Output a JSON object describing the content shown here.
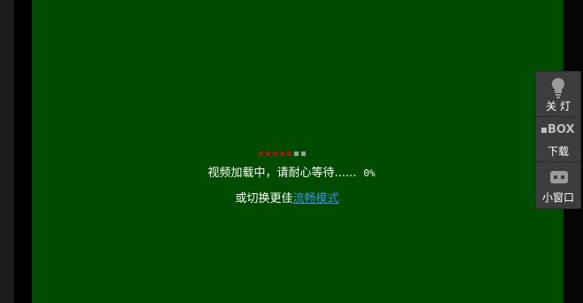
{
  "player": {
    "loading_text": "视频加载中，请耐心等待......",
    "progress_text": "0%",
    "progress_dots": {
      "total": 7,
      "active": 5
    },
    "switch_prefix": "或切换更佳",
    "switch_link": "流畅模式"
  },
  "side_panel": {
    "lights_off_label": "关 灯",
    "box_text": "BOX",
    "download_label": "下载",
    "mini_window_label": "小窗口"
  },
  "colors": {
    "player_bg": "#004b00",
    "dot_active": "#8a1f0c",
    "dot_inactive": "#9aa39a",
    "link": "#3b8ee0",
    "panel_bg": "#3d3d3d"
  },
  "icons": [
    "bulb-icon",
    "box-icon",
    "mini-window-icon"
  ]
}
